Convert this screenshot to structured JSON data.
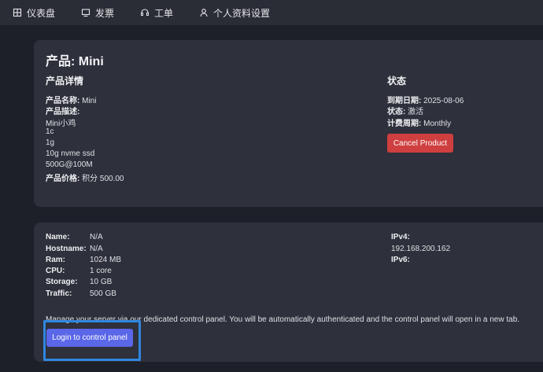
{
  "nav": {
    "items": [
      {
        "label": "仪表盘",
        "icon": "dashboard-icon"
      },
      {
        "label": "发票",
        "icon": "monitor-icon"
      },
      {
        "label": "工单",
        "icon": "headset-icon"
      },
      {
        "label": "个人资料设置",
        "icon": "user-icon"
      }
    ]
  },
  "product": {
    "title": "产品: Mini",
    "details_heading": "产品详情",
    "name_label": "产品名称:",
    "name_value": "Mini",
    "desc_label": "产品描述:",
    "desc_lines": [
      "Mini小鸡",
      "1c",
      "1g",
      "10g nvme ssd",
      "500G@100M"
    ],
    "price_label": "产品价格:",
    "price_value": "积分 500.00",
    "status_heading": "状态",
    "expiry_label": "到期日期:",
    "expiry_value": "2025-08-06",
    "status_label": "状态:",
    "status_value": "激活",
    "cycle_label": "计费周期:",
    "cycle_value": "Monthly",
    "cancel_label": "Cancel Product"
  },
  "server": {
    "rows": [
      {
        "label": "Name:",
        "value": "N/A"
      },
      {
        "label": "Hostname:",
        "value": "N/A"
      },
      {
        "label": "Ram:",
        "value": "1024 MB"
      },
      {
        "label": "CPU:",
        "value": "1 core"
      },
      {
        "label": "Storage:",
        "value": "10 GB"
      },
      {
        "label": "Traffic:",
        "value": "500 GB"
      }
    ],
    "ipv4_label": "IPv4:",
    "ipv4_value": "192.168.200.162",
    "ipv6_label": "IPv6:",
    "manage_text": "Manage your server via our dedicated control panel. You will be automatically authenticated and the control panel will open in a new tab.",
    "login_label": "Login to control panel"
  },
  "colors": {
    "background": "#1e2029",
    "card": "#2e303b",
    "cancel": "#cf3f3f",
    "login": "#5a67e8",
    "highlight": "#2f86de"
  }
}
